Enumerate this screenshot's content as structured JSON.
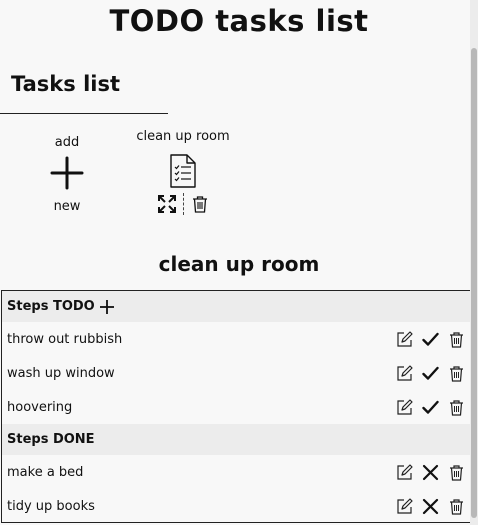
{
  "page": {
    "title": "TODO tasks list"
  },
  "tasks_section": {
    "title": "Tasks list",
    "add_tile": {
      "top_label": "add",
      "bottom_label": "new",
      "icon": "plus-icon"
    },
    "tasks": [
      {
        "name": "clean up room",
        "icon": "document-checklist-icon"
      }
    ]
  },
  "detail": {
    "title": "clean up room",
    "todo_header": "Steps TODO",
    "done_header": "Steps DONE",
    "todo_steps": [
      {
        "label": "throw out rubbish"
      },
      {
        "label": "wash up window"
      },
      {
        "label": "hoovering"
      }
    ],
    "done_steps": [
      {
        "label": "make a bed"
      },
      {
        "label": "tidy up books"
      }
    ]
  }
}
